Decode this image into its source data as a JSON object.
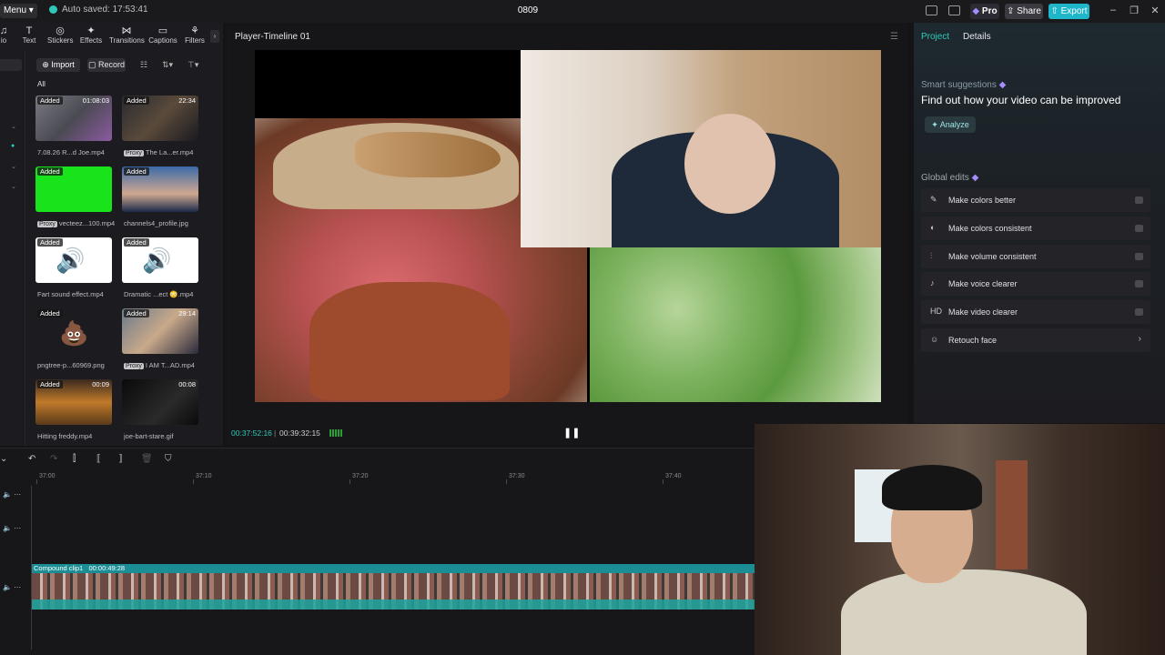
{
  "topbar": {
    "menu_label": "Menu",
    "autosave_text": "Auto saved: 17:53:41",
    "project_title": "0809",
    "pro_label": "Pro",
    "share_label": "Share",
    "export_label": "Export"
  },
  "tools": [
    {
      "label": "io",
      "icon": "audio-icon"
    },
    {
      "label": "Text",
      "icon": "text-icon"
    },
    {
      "label": "Stickers",
      "icon": "stickers-icon"
    },
    {
      "label": "Effects",
      "icon": "effects-icon"
    },
    {
      "label": "Transitions",
      "icon": "transitions-icon"
    },
    {
      "label": "Captions",
      "icon": "captions-icon"
    },
    {
      "label": "Filters",
      "icon": "filters-icon"
    }
  ],
  "media": {
    "import_label": "Import",
    "record_label": "Record",
    "filter_all": "All",
    "items": [
      {
        "name": "7.08.26 R...d Joe.mp4",
        "badge": "Added",
        "duration": "01:08:03",
        "proxy": false,
        "thumb": "video"
      },
      {
        "name": "The La...er.mp4",
        "badge": "Added",
        "duration": "22:34",
        "proxy": true,
        "thumb": "dark"
      },
      {
        "name": "vecteez...100.mp4",
        "badge": "Added",
        "duration": "",
        "proxy": true,
        "thumb": "green"
      },
      {
        "name": "channels4_profile.jpg",
        "badge": "Added",
        "duration": "",
        "proxy": false,
        "thumb": "face"
      },
      {
        "name": "Fart sound effect.mp4",
        "badge": "Added",
        "duration": "",
        "proxy": false,
        "thumb": "speaker"
      },
      {
        "name": "Dramatic ...ect 😳.mp4",
        "badge": "Added",
        "duration": "",
        "proxy": false,
        "thumb": "speaker"
      },
      {
        "name": "pngtree-p...60969.png",
        "badge": "Added",
        "duration": "",
        "proxy": false,
        "thumb": "poop"
      },
      {
        "name": "I AM T...AD.mp4",
        "badge": "Added",
        "duration": "29:14",
        "proxy": true,
        "thumb": "streamer"
      },
      {
        "name": "Hitting freddy.mp4",
        "badge": "Added",
        "duration": "00:09",
        "proxy": false,
        "thumb": "orange"
      },
      {
        "name": "joe-bart-stare.gif",
        "badge": "",
        "duration": "00:08",
        "proxy": false,
        "thumb": "black"
      }
    ]
  },
  "player": {
    "title": "Player-Timeline 01",
    "current_time": "00:37:52:16",
    "total_time": "00:39:32:15"
  },
  "right_panel": {
    "tab_project": "Project",
    "tab_details": "Details",
    "smart_suggestions": "Smart suggestions",
    "improve_text": "Find out how your video can be improved",
    "analyze_label": "Analyze",
    "global_edits": "Global edits",
    "edits": [
      {
        "label": "Make colors better",
        "icon": "✎"
      },
      {
        "label": "Make colors consistent",
        "icon": "◐"
      },
      {
        "label": "Make volume consistent",
        "icon": "⫶"
      },
      {
        "label": "Make voice clearer",
        "icon": "♪"
      },
      {
        "label": "Make video clearer",
        "icon": "HD"
      },
      {
        "label": "Retouch face",
        "icon": "☺"
      }
    ]
  },
  "timeline": {
    "ruler": [
      "37:00",
      "37:10",
      "37:20",
      "37:30",
      "37:40"
    ],
    "clip_name": "Compound clip1",
    "clip_duration": "00:00:49:28"
  },
  "colors": {
    "accent": "#1fb6c9",
    "timecode": "#2fc9b9",
    "clip": "#1b8d94"
  }
}
